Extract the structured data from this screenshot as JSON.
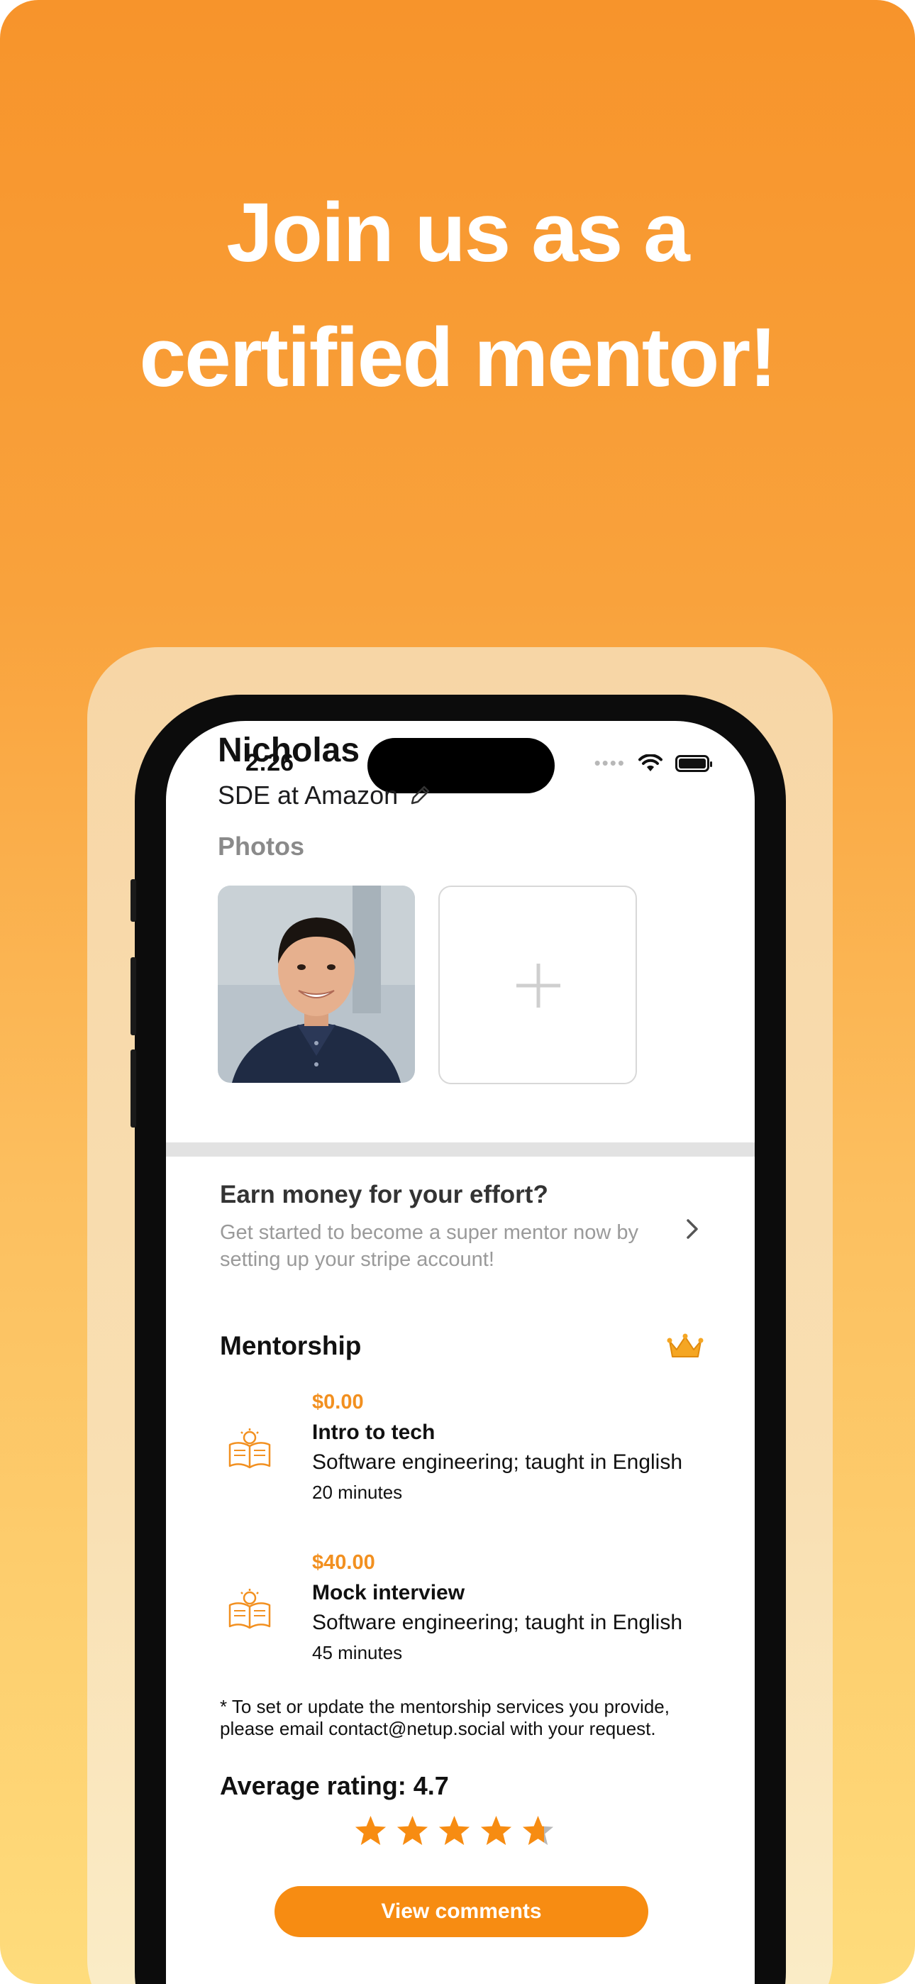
{
  "hero": {
    "line1": "Join us as a",
    "line2": "certified mentor!"
  },
  "status_bar": {
    "time": "2:26",
    "icons": [
      "cellular-signal-icon",
      "wifi-icon",
      "battery-icon"
    ]
  },
  "profile": {
    "name": "Nicholas",
    "role": "SDE at Amazon",
    "edit_icon": "pencil-icon",
    "photos_label": "Photos",
    "add_photo_icon": "plus-icon"
  },
  "earn": {
    "title": "Earn money for your effort?",
    "description": "Get started to become a super mentor now by setting up your stripe account!",
    "chevron_icon": "chevron-right-icon"
  },
  "mentorship": {
    "title": "Mentorship",
    "badge_icon": "crown-icon",
    "services": [
      {
        "price": "$0.00",
        "name": "Intro to tech",
        "description": "Software engineering; taught in English",
        "duration": "20 minutes",
        "icon": "book-lightbulb-icon"
      },
      {
        "price": "$40.00",
        "name": "Mock interview",
        "description": "Software engineering; taught in English",
        "duration": "45 minutes",
        "icon": "book-lightbulb-icon"
      }
    ],
    "note": "* To set or update the mentorship services you provide, please email contact@netup.social with your request."
  },
  "rating": {
    "label": "Average rating: 4.7",
    "value": 4.7,
    "max": 5,
    "button_label": "View comments"
  },
  "colors": {
    "accent": "#f78c12",
    "price": "#f29020",
    "background_top": "#f7942b",
    "background_bottom": "#fedc7c",
    "star": "#f78c12"
  }
}
